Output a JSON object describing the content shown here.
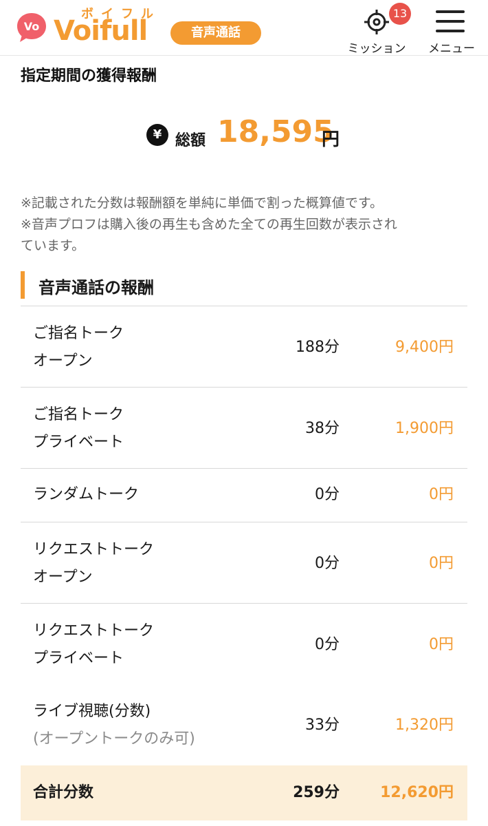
{
  "header": {
    "logo_kana": "ボイフル",
    "logo_word": "Voifull",
    "logo_badge": "Vo",
    "logo_pill": "音声通話",
    "mission": {
      "label": "ミッション",
      "badge": "13",
      "icon": "target-icon"
    },
    "menu": {
      "label": "メニュー",
      "icon": "hamburger-icon"
    }
  },
  "page": {
    "title": "指定期間の獲得報酬",
    "total_label": "総額",
    "total_amount": "18,595",
    "total_unit": "円",
    "yen_symbol": "¥"
  },
  "notes": [
    "※記載された分数は報酬額を単純に単価で割った概算値です。",
    "※音声プロフは購入後の再生も含めた全ての再生回数が表示され",
    "ています。"
  ],
  "section": {
    "title": "音声通話の報酬"
  },
  "rows": [
    {
      "name1": "ご指名トーク",
      "name2": "オープン",
      "minutes": "188分",
      "amount": "9,400円"
    },
    {
      "name1": "ご指名トーク",
      "name2": "プライベート",
      "minutes": "38分",
      "amount": "1,900円"
    },
    {
      "name1": "ランダムトーク",
      "minutes": "0分",
      "amount": "0円"
    },
    {
      "name1": "リクエストトーク",
      "name2": "オープン",
      "minutes": "0分",
      "amount": "0円"
    },
    {
      "name1": "リクエストトーク",
      "name2": "プライベート",
      "minutes": "0分",
      "amount": "0円"
    },
    {
      "name1": "ライブ視聴(分数)",
      "name2": "(オープントークのみ可)",
      "minutes": "33分",
      "amount": "1,320円"
    }
  ],
  "total_row": {
    "label": "合計分数",
    "minutes": "259分",
    "amount": "12,620円"
  },
  "colors": {
    "accent": "#f39b32",
    "badge": "#e8524a",
    "total_bg": "#fcefd9"
  }
}
